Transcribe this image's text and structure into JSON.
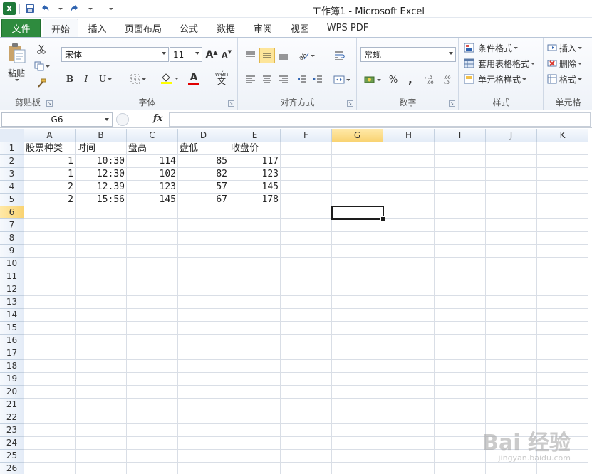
{
  "window": {
    "title": "工作簿1 - Microsoft Excel"
  },
  "qat": {
    "logo": "X",
    "save_icon": "save-icon",
    "undo_icon": "undo-icon",
    "redo_icon": "redo-icon"
  },
  "tabs": [
    {
      "label": "文件"
    },
    {
      "label": "开始"
    },
    {
      "label": "插入"
    },
    {
      "label": "页面布局"
    },
    {
      "label": "公式"
    },
    {
      "label": "数据"
    },
    {
      "label": "审阅"
    },
    {
      "label": "视图"
    },
    {
      "label": "WPS PDF"
    }
  ],
  "ribbon": {
    "clipboard": {
      "label": "剪贴板",
      "paste": "粘贴"
    },
    "font": {
      "label": "字体",
      "name": "宋体",
      "size": "11",
      "bold": "B",
      "italic": "I",
      "underline": "U",
      "grow": "A",
      "shrink": "A",
      "font_color_glyph": "A",
      "phonetic": "wén"
    },
    "alignment": {
      "label": "对齐方式"
    },
    "number": {
      "label": "数字",
      "format": "常规",
      "percent": "%",
      "comma": ","
    },
    "styles": {
      "label": "样式",
      "conditional": "条件格式",
      "table": "套用表格格式",
      "cell": "单元格样式"
    },
    "cells": {
      "label": "单元格",
      "insert": "插入",
      "delete": "删除",
      "format": "格式"
    }
  },
  "formula_bar": {
    "name_box": "G6",
    "fx": "fx",
    "value": ""
  },
  "sheet": {
    "columns": [
      "A",
      "B",
      "C",
      "D",
      "E",
      "F",
      "G",
      "H",
      "I",
      "J",
      "K"
    ],
    "selected_column": "G",
    "selected_row": 6,
    "rows_count": 26,
    "cells": [
      [
        "股票种类",
        "时间",
        "盘高",
        "盘低",
        "收盘价"
      ],
      [
        "1",
        "10:30",
        "114",
        "85",
        "117"
      ],
      [
        "1",
        "12:30",
        "102",
        "82",
        "123"
      ],
      [
        "2",
        "12.39",
        "123",
        "57",
        "145"
      ],
      [
        "2",
        "15:56",
        "145",
        "67",
        "178"
      ]
    ]
  },
  "watermark": {
    "brand": "Bai 经验",
    "url": "jingyan.baidu.com"
  }
}
